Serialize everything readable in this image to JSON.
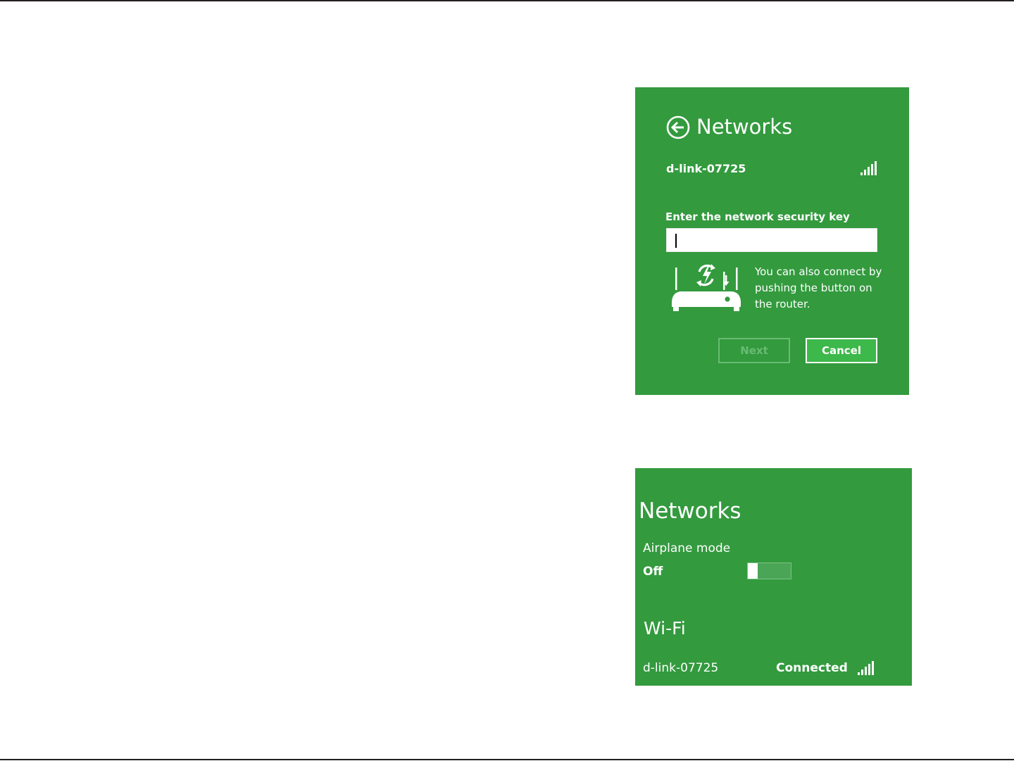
{
  "colors": {
    "panel_background": "#339a3e",
    "text": "#ffffff",
    "cancel_button": "#3db84a",
    "next_button_disabled": "#69bb73"
  },
  "connect_panel": {
    "back_icon": "back-arrow-circle-icon",
    "title": "Networks",
    "network_name": "d-link-07725",
    "signal_icon": "signal-strength-icon",
    "security_key_label": "Enter the network security key",
    "security_key_value": "",
    "router_icon": "wps-router-icon",
    "wps_hint": "You can also connect by pushing the button on the router.",
    "next_label": "Next",
    "cancel_label": "Cancel"
  },
  "status_panel": {
    "title": "Networks",
    "airplane_mode_label": "Airplane mode",
    "airplane_mode_state": "Off",
    "airplane_mode_on": false,
    "wifi_heading": "Wi-Fi",
    "network_name": "d-link-07725",
    "network_status": "Connected",
    "signal_icon": "signal-strength-icon"
  }
}
